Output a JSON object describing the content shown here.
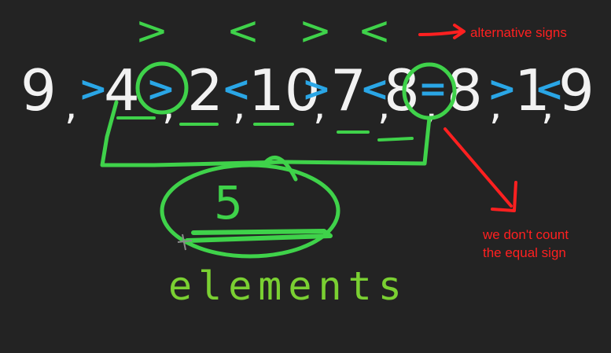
{
  "alternative_signs": [
    ">",
    "<",
    ">",
    "<"
  ],
  "sequence": {
    "numbers": [
      "9",
      "4",
      "2",
      "10",
      "7",
      "8",
      "8",
      "1",
      "9"
    ],
    "operators": [
      ">",
      ">",
      "<",
      ">",
      "<",
      "=",
      ">",
      "<"
    ],
    "separator": ","
  },
  "count": "5",
  "count_label": "elements",
  "annotations": {
    "alternative_signs": "alternative signs",
    "equal_sign_line1": "we don't count",
    "equal_sign_line2": "the equal sign"
  },
  "colors": {
    "background": "#232323",
    "digits": "#f2f2f2",
    "operators": "#2aa6e6",
    "marker": "#3fd24a",
    "word": "#7ad032",
    "annotation": "#ff2020"
  }
}
